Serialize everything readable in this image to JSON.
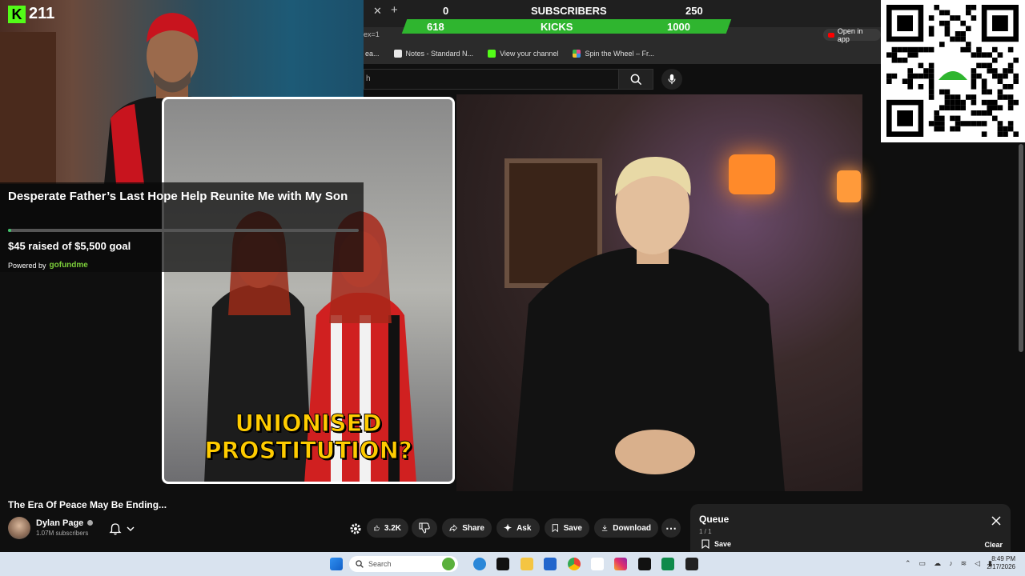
{
  "counter": {
    "subscribers_current": "0",
    "subscribers_label": "SUBSCRIBERS",
    "subscribers_goal": "250",
    "kicks_current": "618",
    "kicks_label": "KICKS",
    "kicks_goal": "1000"
  },
  "kick": {
    "viewer_count": "211",
    "logo_letter": "K"
  },
  "browser": {
    "address_fragment": "ex=1",
    "open_in_app": "Open in app",
    "bookmarks": [
      {
        "label": "ea...",
        "color": "#444444"
      },
      {
        "label": "Notes - Standard N...",
        "color": "#e8e8e8"
      },
      {
        "label": "View your channel",
        "color": "#53fc18"
      },
      {
        "label": "Spin the Wheel – Fr...",
        "color": "#e24c8a"
      }
    ],
    "search_hint": "h"
  },
  "gofundme": {
    "title": "Desperate Father’s Last Hope Help Reunite Me with My Son",
    "raised_text": "$45 raised of $5,500 goal",
    "progress_fraction": 0.008,
    "powered_by": "Powered by",
    "brand": "gofundme"
  },
  "thumbnail": {
    "line1": "UNIONISED",
    "line2": "PROSTITUTION?"
  },
  "video": {
    "title": "The Era Of Peace May Be Ending...",
    "channel": "Dylan Page",
    "subscribers": "1.07M subscribers",
    "likes": "3.2K",
    "share": "Share",
    "ask": "Ask",
    "save": "Save",
    "download": "Download"
  },
  "queue": {
    "title": "Queue",
    "count": "1 / 1",
    "save": "Save",
    "clear": "Clear"
  },
  "taskbar": {
    "search_placeholder": "Search",
    "time": "8:49 PM",
    "date": "2/17/2026"
  },
  "colors": {
    "kick_green": "#53fc18",
    "counter_bar": "#2fb52f",
    "youtube_red": "#ff0000"
  }
}
